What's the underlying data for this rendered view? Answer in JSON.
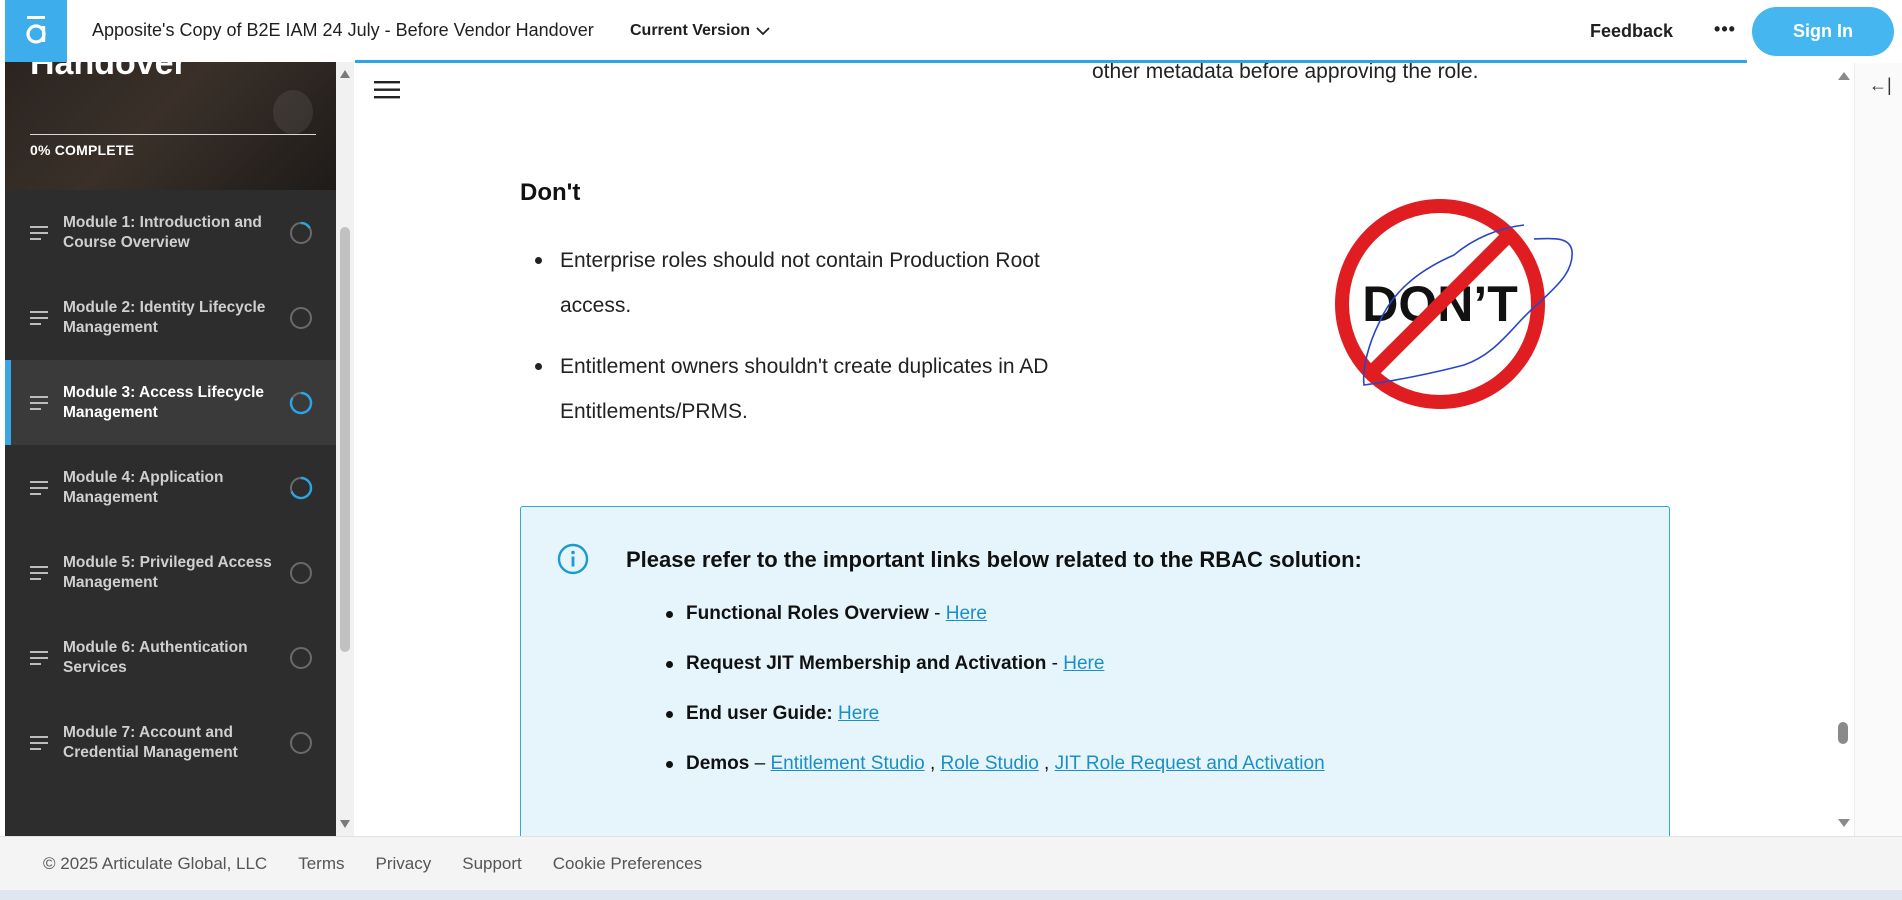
{
  "header": {
    "course_title": "Apposite's Copy of B2E IAM 24 July - Before Vendor Handover",
    "version_label": "Current Version",
    "feedback_label": "Feedback",
    "more_label": "•••",
    "signin_label": "Sign In"
  },
  "sidebar": {
    "hero_title": "Handover",
    "progress_text": "0% COMPLETE",
    "modules": [
      {
        "label": "Module 1: Introduction and Course Overview",
        "status": "in-progress"
      },
      {
        "label": "Module 2: Identity Lifecycle Management",
        "status": "not-started"
      },
      {
        "label": "Module 3: Access Lifecycle Management",
        "status": "in-progress",
        "active": true
      },
      {
        "label": "Module 4: Application Management",
        "status": "in-progress"
      },
      {
        "label": "Module 5: Privileged Access Management",
        "status": "not-started"
      },
      {
        "label": "Module 6: Authentication Services",
        "status": "not-started"
      },
      {
        "label": "Module 7: Account and Credential Management",
        "status": "not-started"
      }
    ]
  },
  "content": {
    "prev_text": "other metadata before approving the role.",
    "dont_heading": "Don't",
    "dont_bullets": [
      "Enterprise roles should not contain Production Root access.",
      "Entitlement owners shouldn't create duplicates in AD Entitlements/PRMS."
    ],
    "dont_image_text": "DON’T",
    "callout": {
      "title": "Please refer to the important links below related to the RBAC solution:",
      "links": [
        {
          "label": "Functional Roles Overview",
          "sep": " - ",
          "link_text": "Here"
        },
        {
          "label": "Request JIT Membership and Activation",
          "sep": " - ",
          "link_text": "Here"
        },
        {
          "label": "End user Guide:",
          "sep": " ",
          "link_text": "Here"
        }
      ],
      "demos": {
        "label": "Demos",
        "sep": " – ",
        "links": [
          "Entitlement Studio",
          "Role Studio",
          "JIT Role Request and Activation"
        ],
        "joiner": " , "
      }
    }
  },
  "right_rail": {
    "collapse_label": "←|"
  },
  "footer": {
    "copyright": "© 2025 Articulate Global, LLC",
    "links": [
      "Terms",
      "Privacy",
      "Support",
      "Cookie Preferences"
    ]
  },
  "colors": {
    "accent": "#3dadeb",
    "link": "#1a8fc7",
    "callout_bg": "#e5f5fb",
    "sidebar_bg": "#2d2d2d"
  }
}
